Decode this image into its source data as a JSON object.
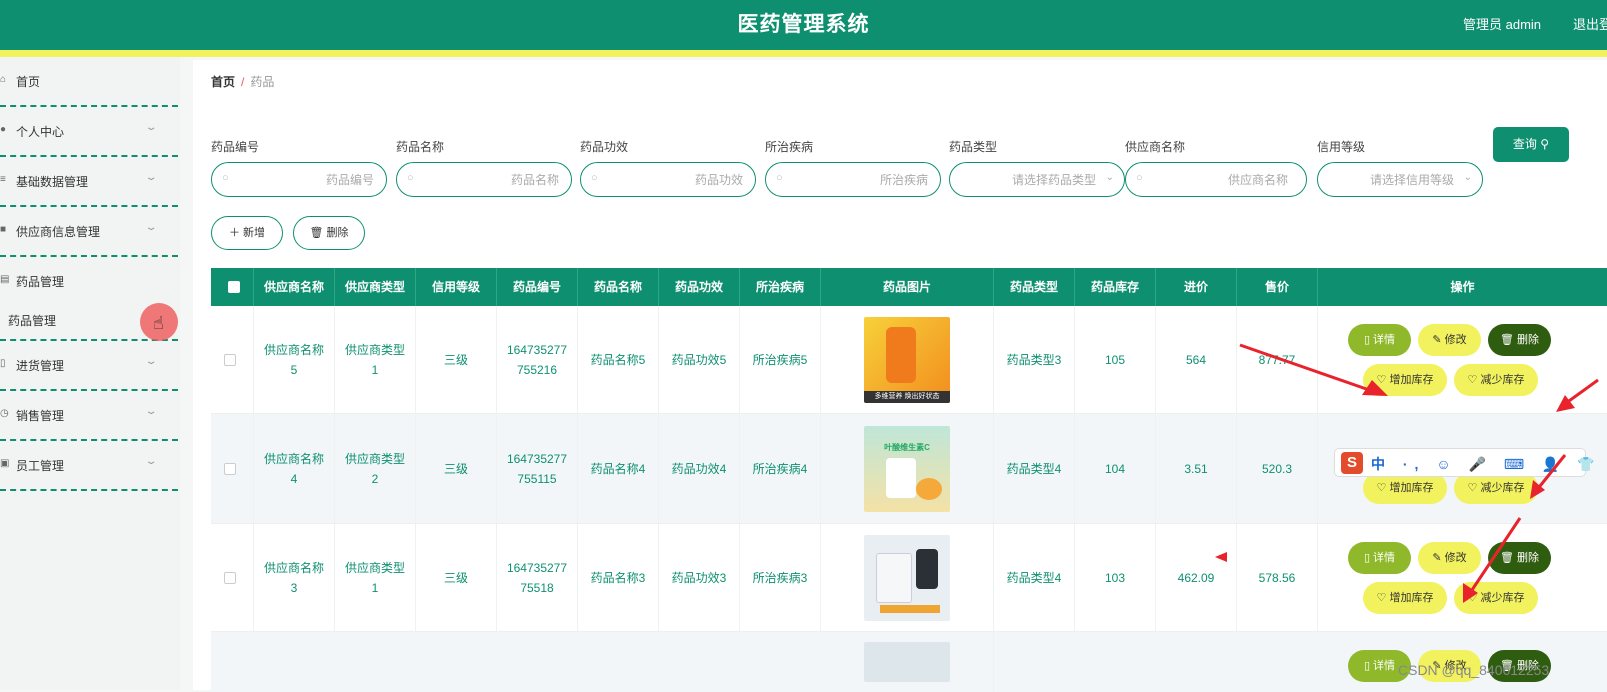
{
  "header": {
    "title": "医药管理系统",
    "admin_text": "管理员 admin",
    "logout_text": "退出登"
  },
  "sidebar": {
    "items": [
      {
        "label": "首页",
        "icon": "home-icon"
      },
      {
        "label": "个人中心",
        "icon": "user-icon"
      },
      {
        "label": "基础数据管理",
        "icon": "list-icon"
      },
      {
        "label": "供应商信息管理",
        "icon": "truck-icon"
      },
      {
        "label": "药品管理",
        "icon": "folder-icon"
      },
      {
        "label": "进货管理",
        "icon": "cart-icon"
      },
      {
        "label": "销售管理",
        "icon": "clock-icon"
      },
      {
        "label": "员工管理",
        "icon": "id-card-icon"
      }
    ],
    "submenu_item": "药品管理"
  },
  "breadcrumb": {
    "home": "首页",
    "separator": "/",
    "current": "药品"
  },
  "filters": [
    {
      "label": "药品编号",
      "placeholder": "药品编号",
      "type": "text"
    },
    {
      "label": "药品名称",
      "placeholder": "药品名称",
      "type": "text"
    },
    {
      "label": "药品功效",
      "placeholder": "药品功效",
      "type": "text"
    },
    {
      "label": "所治疾病",
      "placeholder": "所治疾病",
      "type": "text"
    },
    {
      "label": "药品类型",
      "placeholder": "请选择药品类型",
      "type": "select"
    },
    {
      "label": "供应商名称",
      "placeholder": "供应商名称",
      "type": "text"
    },
    {
      "label": "信用等级",
      "placeholder": "请选择信用等级",
      "type": "select"
    }
  ],
  "toolbar": {
    "query_label": "查询",
    "add_label": "新增",
    "delete_label": "删除"
  },
  "table": {
    "columns": [
      "供应商名称",
      "供应商类型",
      "信用等级",
      "药品编号",
      "药品名称",
      "药品功效",
      "所治疾病",
      "药品图片",
      "药品类型",
      "药品库存",
      "进价",
      "售价",
      "操作"
    ],
    "rows": [
      {
        "supplier": "供应商名称5",
        "supplier_type": "供应商类型1",
        "credit": "三级",
        "code": "164735277755216",
        "name": "药品名称5",
        "effect": "药品功效5",
        "disease": "所治疾病5",
        "image_caption": "多维营养 焕出好状态",
        "type": "药品类型3",
        "stock": "105",
        "cost": "564",
        "price": "877.77"
      },
      {
        "supplier": "供应商名称4",
        "supplier_type": "供应商类型2",
        "credit": "三级",
        "code": "164735277755115",
        "name": "药品名称4",
        "effect": "药品功效4",
        "disease": "所治疾病4",
        "image_caption": "叶酸维生素C",
        "type": "药品类型4",
        "stock": "104",
        "cost": "3.51",
        "price": "520.3"
      },
      {
        "supplier": "供应商名称3",
        "supplier_type": "供应商类型1",
        "credit": "三级",
        "code": "16473527775518",
        "name": "药品名称3",
        "effect": "药品功效3",
        "disease": "所治疾病3",
        "image_caption": "",
        "type": "药品类型4",
        "stock": "103",
        "cost": "462.09",
        "price": "578.56"
      }
    ],
    "actions": {
      "detail": "详情",
      "edit": "修改",
      "delete": "删除",
      "add_stock": "增加库存",
      "reduce_stock": "减少库存"
    }
  },
  "ime_toolbar": {
    "text": "中 ·, ☺ 🎤 ⌨ 👤 👕 简 ⚏"
  },
  "watermark": "CSDN @qq_840612253",
  "colors": {
    "primary": "#0e9070",
    "accent_yellow": "#f2f25e",
    "detail_green": "#8fb92a",
    "delete_dark": "#2f5d10",
    "annotation_red": "#e8232b"
  }
}
